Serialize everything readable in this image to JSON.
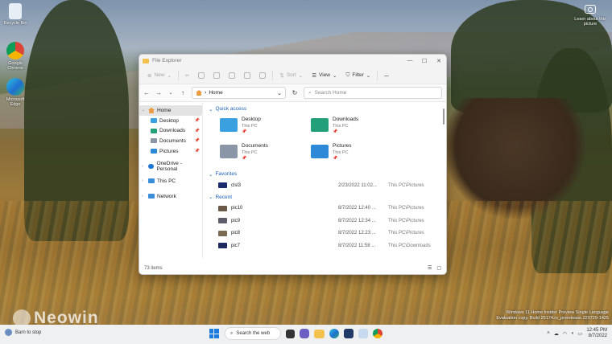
{
  "desktop": {
    "icons": [
      {
        "label": "Recycle Bin"
      },
      {
        "label": "Google Chrome"
      },
      {
        "label": "Microsoft Edge"
      }
    ],
    "camera_label": "Learn about this picture",
    "watermark_line1": "Windows 11 Home Insider Preview Single Language",
    "watermark_line2": "Evaluation copy. Build 25174.rs_prerelease.220729-1425",
    "neowin": "Neowin",
    "bg_hint": "Barn to stop"
  },
  "window": {
    "title": "File Explorer",
    "toolbar": {
      "new": "New",
      "sort": "Sort",
      "view": "View",
      "filter": "Filter",
      "more": "..."
    },
    "address": "Home",
    "search_placeholder": "Search Home",
    "sidebar": {
      "home": "Home",
      "quick": [
        {
          "label": "Desktop"
        },
        {
          "label": "Downloads"
        },
        {
          "label": "Documents"
        },
        {
          "label": "Pictures"
        }
      ],
      "onedrive": "OneDrive - Personal",
      "thispc": "This PC",
      "network": "Network"
    },
    "sections": {
      "quick_access": "Quick access",
      "favorites": "Favorites",
      "recent": "Recent"
    },
    "quick_access": [
      {
        "name": "Desktop",
        "sub": "This PC",
        "color": "#3aa0e0"
      },
      {
        "name": "Downloads",
        "sub": "This PC",
        "color": "#23a07a"
      },
      {
        "name": "Documents",
        "sub": "This PC",
        "color": "#8a96a8"
      },
      {
        "name": "Pictures",
        "sub": "This PC",
        "color": "#2d8ad8"
      }
    ],
    "favorites": [
      {
        "name": "clsl3",
        "date": "2/23/2022 11:02...",
        "loc": "This PC\\Pictures"
      }
    ],
    "recent": [
      {
        "name": "pic10",
        "date": "8/7/2022 12:40 ...",
        "loc": "This PC\\Pictures"
      },
      {
        "name": "pic9",
        "date": "8/7/2022 12:34 ...",
        "loc": "This PC\\Pictures"
      },
      {
        "name": "pic8",
        "date": "8/7/2022 12:23 ...",
        "loc": "This PC\\Pictures"
      },
      {
        "name": "pic7",
        "date": "8/7/2022 11:58 ...",
        "loc": "This PC\\Downloads"
      }
    ],
    "status": "73 items"
  },
  "taskbar": {
    "search": "Search the web",
    "time": "12:45 PM",
    "date": "8/7/2022"
  }
}
